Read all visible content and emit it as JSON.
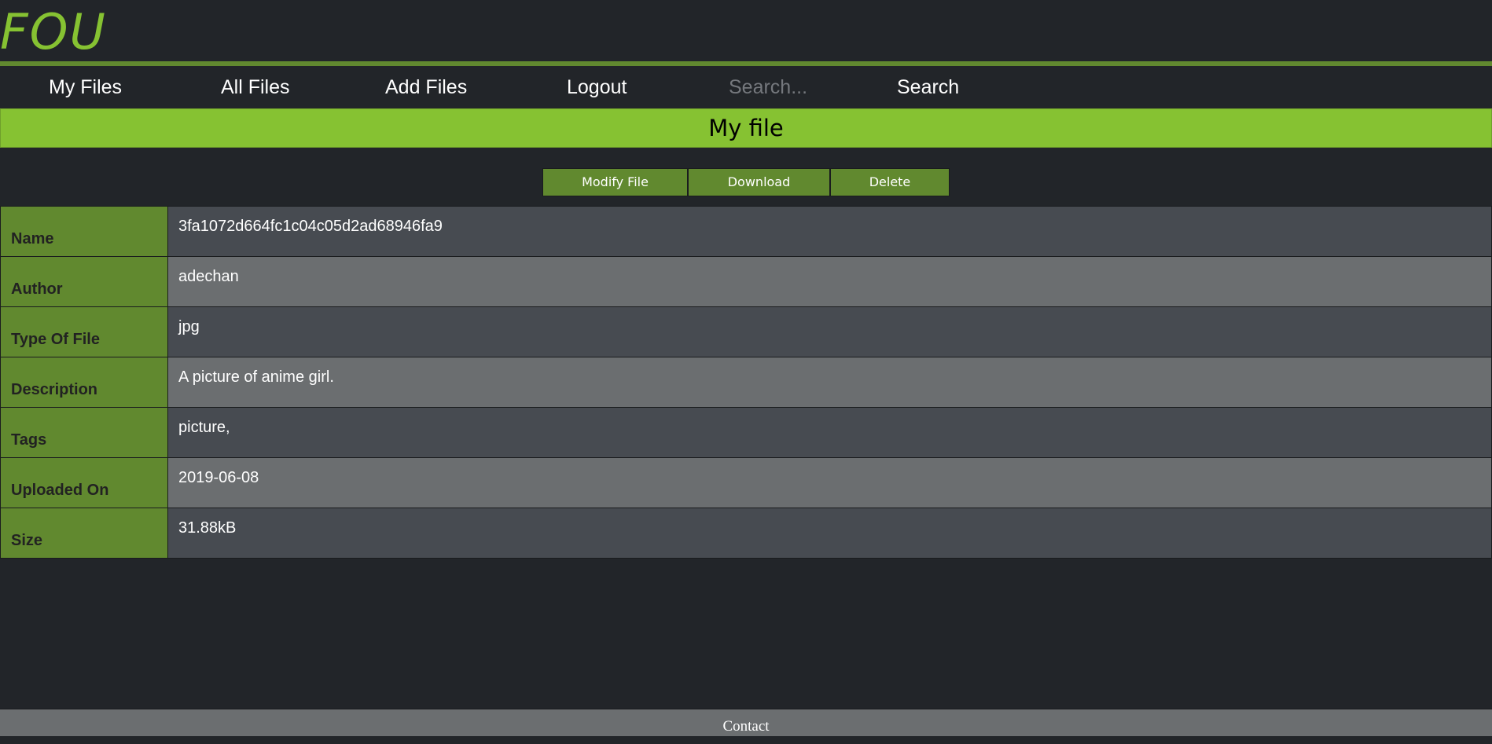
{
  "header": {
    "logo": "FOU"
  },
  "nav": {
    "my_files": "My Files",
    "all_files": "All Files",
    "add_files": "Add Files",
    "logout": "Logout",
    "search_placeholder": "Search...",
    "search_value": "",
    "search_button": "Search"
  },
  "page": {
    "title": "My file"
  },
  "actions": {
    "modify": "Modify File",
    "download": "Download",
    "delete": "Delete"
  },
  "file_info": [
    {
      "label": "Name",
      "value": "3fa1072d664fc1c04c05d2ad68946fa9"
    },
    {
      "label": "Author",
      "value": "adechan"
    },
    {
      "label": "Type Of File",
      "value": "jpg"
    },
    {
      "label": "Description",
      "value": "A picture of anime girl."
    },
    {
      "label": "Tags",
      "value": "picture,"
    },
    {
      "label": "Uploaded On",
      "value": "2019-06-08"
    },
    {
      "label": "Size",
      "value": "31.88kB"
    }
  ],
  "footer": {
    "contact": "Contact"
  },
  "colors": {
    "accent": "#86c232",
    "accent_dark": "#61892f",
    "background": "#222529",
    "row_dark": "#474b51",
    "row_light": "#6b6e70"
  }
}
